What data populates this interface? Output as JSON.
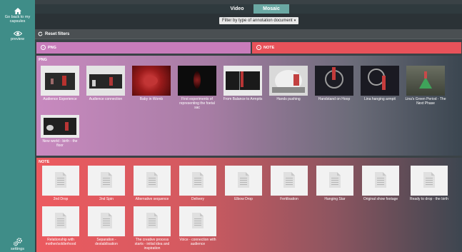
{
  "sidebar": {
    "home_label": "Go back to my capsules",
    "home_icon": "home-icon",
    "preview_label": "preview",
    "preview_icon": "eye-icon",
    "settings_label": "settings",
    "settings_icon": "gears-icon"
  },
  "tabs": [
    {
      "label": "Video",
      "active": false
    },
    {
      "label": "Mosaic",
      "active": true
    }
  ],
  "filter": {
    "selected": "Filter by type of annotation document"
  },
  "reset": {
    "label": "Reset filters",
    "icon": "refresh-icon"
  },
  "type_filters": [
    {
      "label": "PNG",
      "color": "#c87cbb"
    },
    {
      "label": "NOTE",
      "color": "#e8525a"
    }
  ],
  "png_section": {
    "title": "PNG",
    "items": [
      {
        "caption": "Audience Experience"
      },
      {
        "caption": "Audience connection"
      },
      {
        "caption": "Baby in Womb"
      },
      {
        "caption": "First experiments of representing the foetal sac"
      },
      {
        "caption": "From Balance to Armpits"
      },
      {
        "caption": "Hands pushing"
      },
      {
        "caption": "Handstand on Hoop"
      },
      {
        "caption": "Lina hanging armpit"
      },
      {
        "caption": "Lina's Green Period - The Next Phase"
      },
      {
        "caption": "New world - birth - the floor"
      }
    ]
  },
  "note_section": {
    "title": "NOTE",
    "items": [
      {
        "caption": "2nd Drop"
      },
      {
        "caption": "2nd Spin"
      },
      {
        "caption": "Alternative sequence"
      },
      {
        "caption": "Delivery"
      },
      {
        "caption": "Elbow Drop"
      },
      {
        "caption": "Fertilisation"
      },
      {
        "caption": "Hanging Star"
      },
      {
        "caption": "Original show footage"
      },
      {
        "caption": "Ready to drop - the birth"
      },
      {
        "caption": "Relationship with mother/soldierhood"
      },
      {
        "caption": "Separation - destabilisation"
      },
      {
        "caption": "The creative process starts - initial idea and inspiration"
      },
      {
        "caption": "Voice - connection with audience"
      }
    ]
  },
  "colors": {
    "sidebar": "#3f8d88",
    "active_tab": "#6aa8a3",
    "png_accent": "#c87cbb",
    "note_accent": "#e8525a"
  }
}
